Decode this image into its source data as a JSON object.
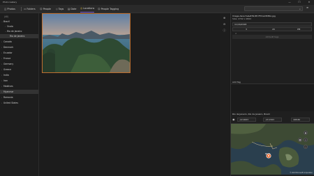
{
  "window": {
    "title": "Photo Gallery",
    "minimize": "—",
    "maximize": "☐",
    "close": "✕"
  },
  "toolbar": {
    "items": [
      {
        "icon": "◫",
        "label": "Photos"
      },
      {
        "icon": "▭",
        "label": "Folders"
      },
      {
        "icon": "☺",
        "label": "People"
      },
      {
        "icon": "◇",
        "label": "Tags"
      },
      {
        "icon": "▤",
        "label": "Date"
      },
      {
        "icon": "◎",
        "label": "Locations"
      },
      {
        "icon": "☺",
        "label": "People Tagging"
      }
    ],
    "search_icon": "⌕",
    "menu_icon": "≡"
  },
  "sidebar": {
    "items": [
      {
        "label": "(All)"
      },
      {
        "label": "Brazil"
      },
      {
        "label": "Ocala"
      },
      {
        "label": "Rio de Janeiro"
      },
      {
        "label": "Rio de Janeiro"
      },
      {
        "label": "Canada"
      },
      {
        "label": "Denmark"
      },
      {
        "label": "Ecuador"
      },
      {
        "label": "France"
      },
      {
        "label": "Germany"
      },
      {
        "label": "Greece"
      },
      {
        "label": "India"
      },
      {
        "label": "Iran"
      },
      {
        "label": "Maldives"
      },
      {
        "label": "Myanmar"
      },
      {
        "label": "Romania"
      },
      {
        "label": "United States"
      }
    ]
  },
  "vtools": {
    "zoom_in": "⊕",
    "zoom_out": "⊖",
    "info": "ⓘ"
  },
  "panel": {
    "filename": "Image-derecha&#39;8E-FEhrsd3MDA.jpg",
    "size": "Size: 2702 x 2822",
    "date": "11/16/2018",
    "time_parts": [
      "3",
      "20",
      "PM"
    ],
    "nav_up": "∧",
    "nav_down": "∨",
    "timeline_button": "Add/edit tags",
    "tag_header": "Add Tag",
    "location_header": "Rio de Janeiro, Rio de Janeiro, Brazil",
    "lat": "-22.9003",
    "lon": "-43.1563",
    "alt": "408.86",
    "map_pin_label": "Photo",
    "map_credit": "© 2023 Microsoft Corporation"
  }
}
